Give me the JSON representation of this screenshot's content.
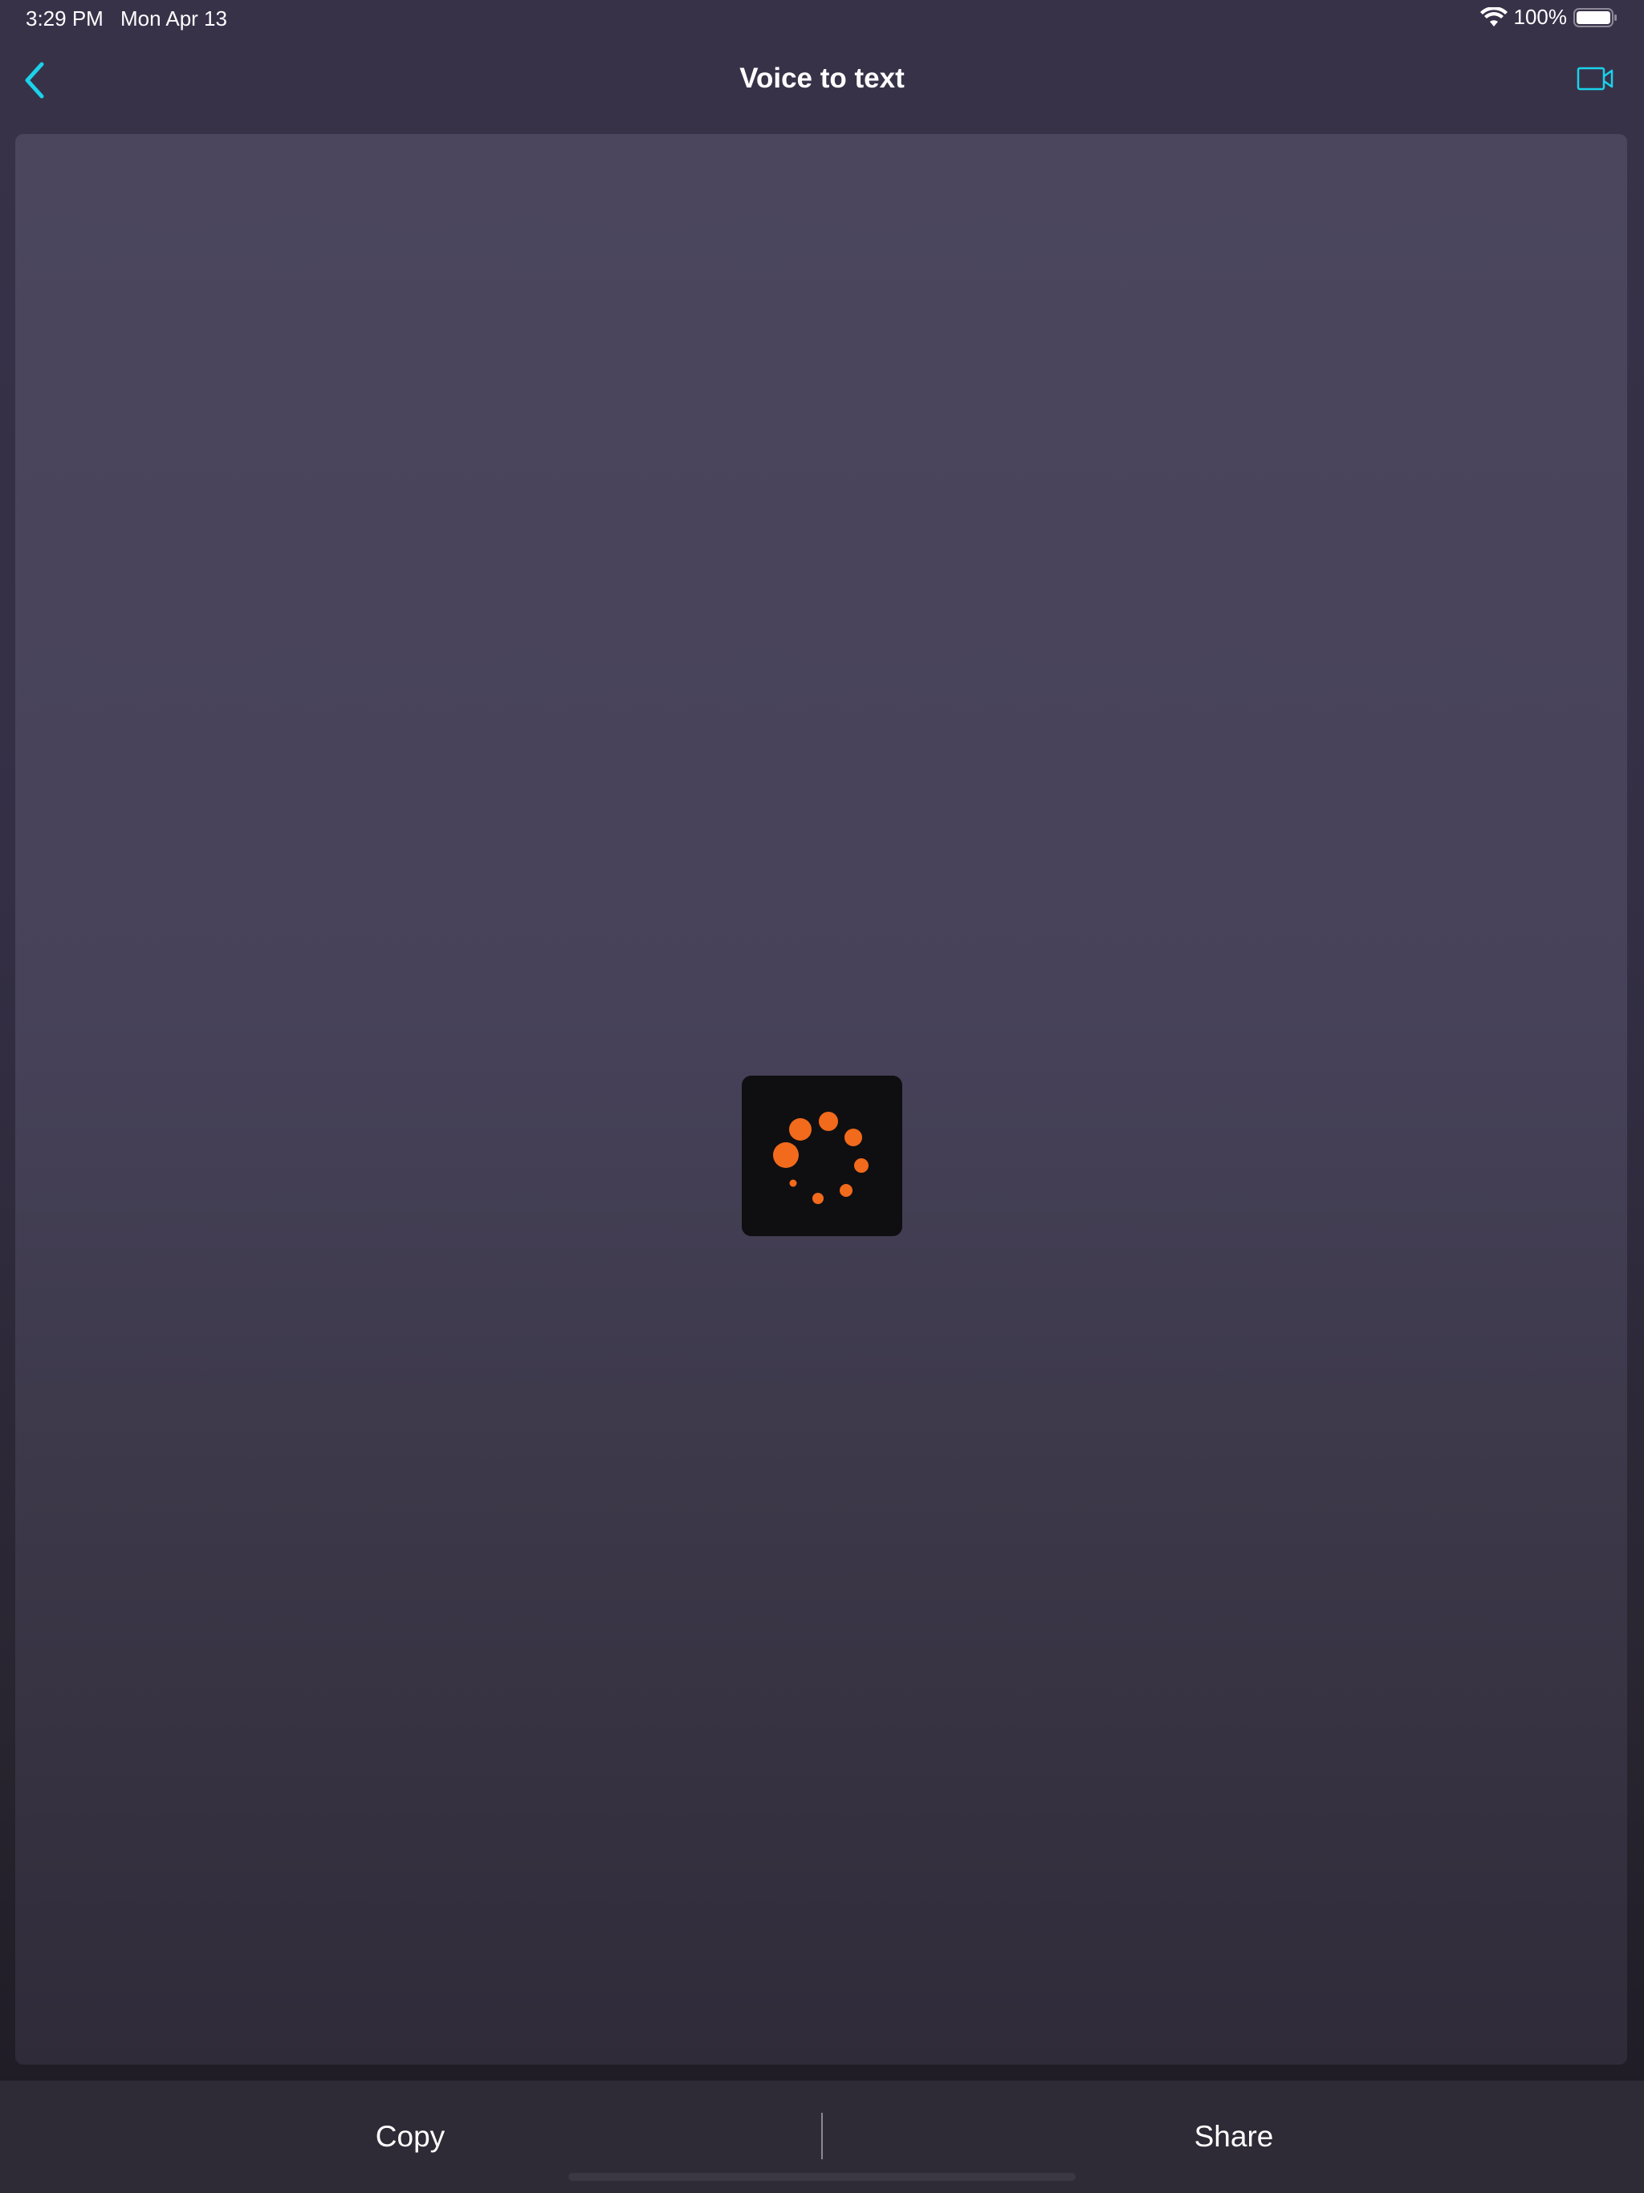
{
  "status_bar": {
    "time": "3:29 PM",
    "date": "Mon Apr 13",
    "battery": "100%"
  },
  "nav": {
    "title": "Voice to text",
    "back_icon": "chevron-left-icon",
    "video_icon": "video-camera-icon"
  },
  "loader": {
    "icon": "loading-spinner-icon",
    "color": "#f26a1b"
  },
  "bottom_bar": {
    "copy_label": "Copy",
    "share_label": "Share"
  },
  "colors": {
    "accent": "#1ad2ea",
    "spinner": "#f26a1b"
  }
}
